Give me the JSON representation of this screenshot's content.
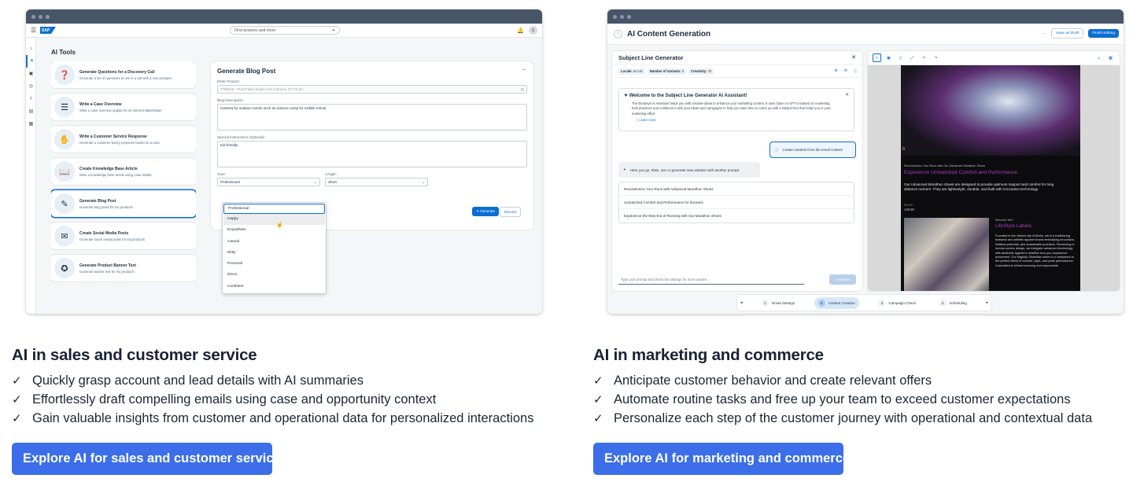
{
  "left": {
    "app": {
      "search_placeholder": "Find answers and more",
      "logo_text": "SAP",
      "avatar_initial": "U",
      "page_title": "AI Tools",
      "tools": [
        {
          "title": "Generate Questions for a Discovery Call",
          "desc": "Generate a set of questions to use in a call with a new prospect",
          "icon": "question-icon"
        },
        {
          "title": "Write a Case Overview",
          "desc": "Write a case overview update for an internal stakeholder",
          "icon": "case-icon"
        },
        {
          "title": "Write a Customer Service Response",
          "desc": "Generate a customer facing response based on a case",
          "icon": "handshake-icon"
        },
        {
          "title": "Create Knowledge Base Article",
          "desc": "Write a knowledge base article using case details",
          "icon": "book-icon"
        },
        {
          "title": "Generate Blog Post",
          "desc": "Generate blog posts for my products",
          "icon": "pencil-icon"
        },
        {
          "title": "Create Social Media Posts",
          "desc": "Generate social media posts for my products",
          "icon": "chat-icon"
        },
        {
          "title": "Generate Product Banner Text",
          "desc": "Generate banner text for my products",
          "icon": "banner-icon"
        }
      ],
      "blog": {
        "title": "Generate Blog Post",
        "product_label": "Enter Product:",
        "product_value": "7788415 - FUN Flash Single Use Camera, 27+12 pic",
        "desc_label": "Blog Description:",
        "desc_value": "Camera for outdoor events such as science camp for middle school.",
        "instr_label": "Special Instructions (Optional) :",
        "instr_value": "Kid friendly",
        "tone_label": "Tone:",
        "tone_value": "Professional",
        "length_label": "Length:",
        "length_value": "Short",
        "generate_label": "Generate",
        "discard_label": "Discard",
        "tone_options": [
          "Professional",
          "Happy",
          "Empathetic",
          "Casual",
          "Witty",
          "Personal",
          "Direct",
          "Confident"
        ]
      }
    },
    "heading": "AI in sales and customer service",
    "bullets": [
      "Quickly grasp account and lead details with AI summaries",
      "Effortlessly draft compelling emails using case and opportunity context",
      "Gain valuable insights from customer and operational data for personalized interactions"
    ],
    "cta": "Explore AI for sales and customer service"
  },
  "right": {
    "app": {
      "title": "AI Content Generation",
      "more_label": "···",
      "save_draft": "Save as Draft",
      "finish": "Finish Editing",
      "panel_title": "Subject Line Generator",
      "locale_label": "Locale:",
      "locale_value": "en-US",
      "variants_label": "Number of Variants:",
      "variants_value": "3",
      "creativity_label": "Creativity:",
      "creativity_value": "70",
      "welcome_title": "Welcome to the Subject Line Generator AI Assistant!",
      "welcome_body": "The Emarsys AI Assistant helps you with creative ideas to enhance your marketing content. It uses Open AI GPT-4 trained on marketing best practices and combines it with your ideas and campaigns to help you save time to come up with a subject line that helps you in your marketing effort.",
      "learn_more": "Learn more",
      "user_prompt": "Create variants from the email content",
      "assistant_reply": "Here you go. Rate, use or generate new variants with another prompt.",
      "variants": [
        "Revolutionize Your Runs with Advanced Marathon Shoes",
        "Unmatched Comfort and Performance for Runners",
        "Experience the New Era of Running with Our Marathon Shoes"
      ],
      "prompt_placeholder": "Type your prompt and check the settings for more options",
      "generate_label": "Generate",
      "email": {
        "shoe_mark": "b",
        "pre": "Revolutionize Your Runs with Our Advanced Marathon Shoes",
        "headline": "Experience Unmatched Comfort and Performance",
        "body": "Our Advanced Marathon shoes are designed to provide optimum support and comfort for long distance runners. They are lightweight, durable, and built with innovative technology.",
        "price_label": "$99.99",
        "price": "149.99",
        "who": "Who Are We?",
        "brand": "LifeStyle Labels",
        "founded": "Founded in the vibrant city of Berlin, we is a trailblazing footwear and athletic apparel brand embodying innovation, limitless potential, and sustainable practices. Pioneering in human-centric design, we integrate advanced technology with aesthetic appeal to redefine how you experience movement. Our flagship GlideMax series is a testament to the perfect blend of comfort, style, and peak performance. Committed to ethical sourcing and responsible"
      },
      "steps": [
        {
          "num": "1",
          "label": "Email Settings"
        },
        {
          "num": "2",
          "label": "Content Creation"
        },
        {
          "num": "3",
          "label": "Campaign Check"
        },
        {
          "num": "4",
          "label": "Scheduling"
        }
      ]
    },
    "heading": "AI in marketing and commerce",
    "bullets": [
      "Anticipate customer behavior and create relevant offers",
      "Automate routine tasks and free up your team to exceed customer expectations",
      "Personalize each step of the customer journey with operational and contextual data"
    ],
    "cta": "Explore AI for marketing and commerce"
  },
  "colors": {
    "accent": "#0a6ed1",
    "cta": "#3b6ee8",
    "brand_purple": "#a63db8"
  }
}
